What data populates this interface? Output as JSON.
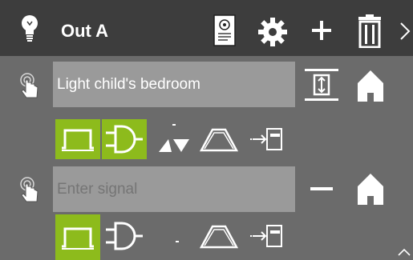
{
  "header": {
    "title": "Out A",
    "icons": [
      "lightbulb-icon",
      "document-icon",
      "settings-gear-icon",
      "add-icon",
      "delete-trash-icon",
      "chevron-right-icon"
    ]
  },
  "rows": [
    {
      "signal_value": "Light child's bedroom",
      "signal_placeholder": "Enter signal",
      "mode_icon": "toggle-range-icon",
      "home_icon": "home-icon",
      "tiles": [
        {
          "icon": "pulse-icon",
          "active": true
        },
        {
          "icon": "and-gate-icon",
          "active": true
        },
        {
          "icon": "triangles-icon",
          "active": false,
          "label": "-"
        },
        {
          "icon": "ramp-icon",
          "active": false
        },
        {
          "icon": "output-arrow-icon",
          "active": false
        }
      ]
    },
    {
      "signal_value": "",
      "signal_placeholder": "Enter signal",
      "mode_icon": "minus-icon",
      "home_icon": "home-icon",
      "tiles": [
        {
          "icon": "pulse-icon",
          "active": true
        },
        {
          "icon": "and-gate-icon",
          "active": false
        },
        {
          "icon": "dash-icon",
          "active": false,
          "label": "-"
        },
        {
          "icon": "ramp-icon",
          "active": false
        },
        {
          "icon": "output-arrow-icon",
          "active": false
        }
      ]
    }
  ],
  "colors": {
    "topbar": "#3d3d3d",
    "background": "#6b6b6b",
    "field": "#9a9a9a",
    "accent": "#8dbb1c"
  },
  "footer": {
    "scroll_icon": "chevron-up-icon"
  }
}
